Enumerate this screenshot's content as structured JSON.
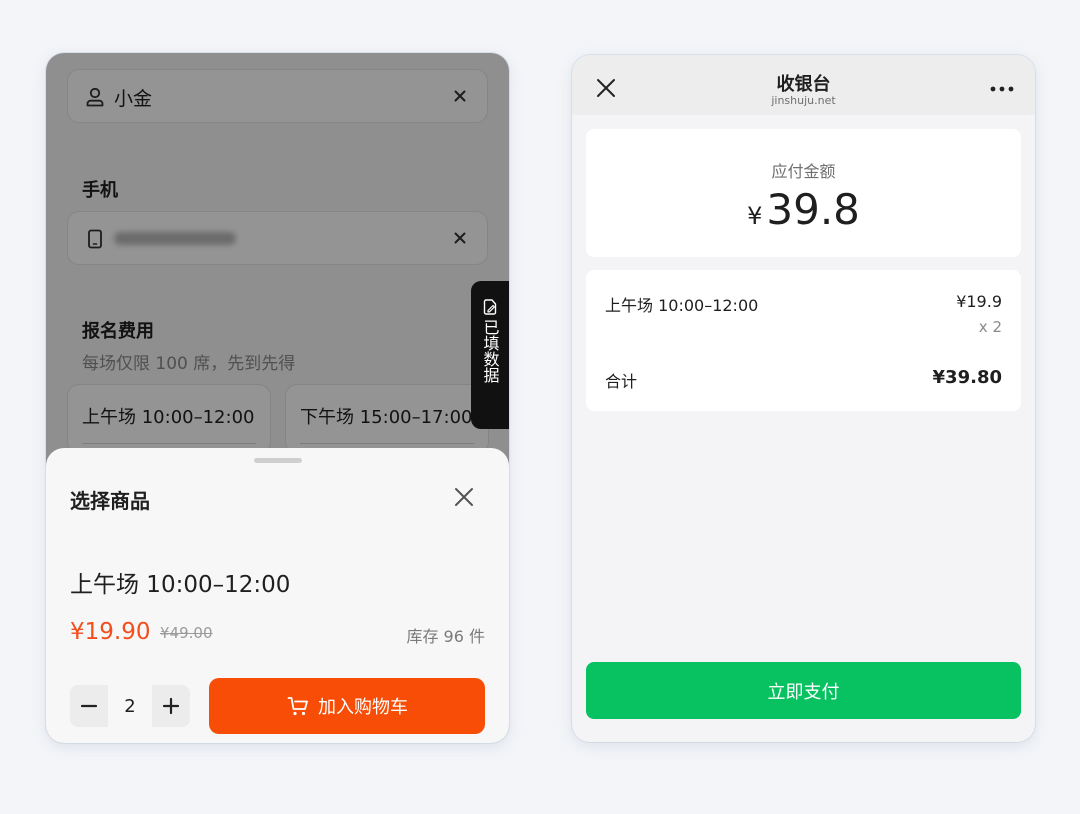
{
  "left": {
    "name_field": {
      "value": "小金"
    },
    "phone_label": "手机",
    "fee_label": "报名费用",
    "fee_desc": "每场仅限 100 席，先到先得",
    "sessions": [
      "上午场 10:00–12:00",
      "下午场 15:00–17:00"
    ],
    "filled_tab": "已填数据",
    "sheet": {
      "title": "选择商品",
      "product_name": "上午场 10:00–12:00",
      "price": "¥19.90",
      "original_price": "¥49.00",
      "stock": "库存 96 件",
      "quantity": "2",
      "add_cart": "加入购物车"
    },
    "colors": {
      "accent": "#f74d06",
      "price": "#f24e1e"
    }
  },
  "right": {
    "title": "收银台",
    "subtitle": "jinshuju.net",
    "payable_label": "应付金额",
    "currency": "¥",
    "amount": "39.8",
    "item": {
      "name": "上午场 10:00–12:00",
      "price": "¥19.9",
      "qty": "x 2"
    },
    "total_label": "合计",
    "total": "¥39.80",
    "pay_button": "立即支付",
    "colors": {
      "pay_button": "#08c160"
    }
  }
}
